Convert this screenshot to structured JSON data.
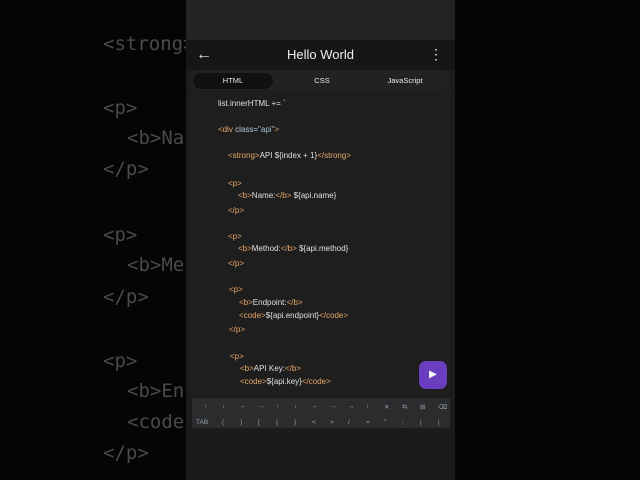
{
  "background_left": [
    "<strong>",
    "<p>",
    "<b>Na",
    "</p>",
    "<p>",
    "<b>Me",
    "</p>",
    "<p>",
    "<b>En",
    "<code",
    "</p>"
  ],
  "header": {
    "title": "Hello World",
    "back_icon": "←",
    "menu_icon": "⋮"
  },
  "tabs": [
    {
      "label": "HTML"
    },
    {
      "label": "CSS"
    },
    {
      "label": "JavaScript"
    }
  ],
  "code": {
    "l1": "list.innerHTML += `",
    "l2_tag": "<div",
    "l2_attr": " class=",
    "l2_val": "\"api\"",
    "l2_end": ">",
    "l3_open": "<strong>",
    "l3_text": "API ${index + 1}",
    "l3_close": "</strong>",
    "p_open": "<p>",
    "p_close": "</p>",
    "b_open": "<b>",
    "b_close": "</b>",
    "code_open": "<code>",
    "code_close": "</code>",
    "name_label": "Name:",
    "name_value": " ${api.name}",
    "method_label": "Method:",
    "method_value": " ${api.method}",
    "endpoint_label": "Endpoint:",
    "endpoint_value": "${api.endpoint}",
    "key_label": "API Key:",
    "key_value": "${api.key}"
  },
  "run_button": {
    "icon": "▶"
  },
  "keyboard": {
    "row1": [
      "↑",
      "↓",
      "←",
      "→",
      "↑",
      "↓",
      "←",
      "→",
      "↔",
      "↕",
      "✕",
      "⇆",
      "⊞",
      "⌫"
    ],
    "row2": [
      "TAB",
      "(",
      ")",
      "[",
      "{",
      "}",
      "<",
      ">",
      "/",
      "=",
      "\"",
      ";",
      "|",
      "|"
    ]
  },
  "colors": {
    "accent": "#6a3fbf",
    "tag": "#e8a86a",
    "value": "#a0c4d8"
  }
}
